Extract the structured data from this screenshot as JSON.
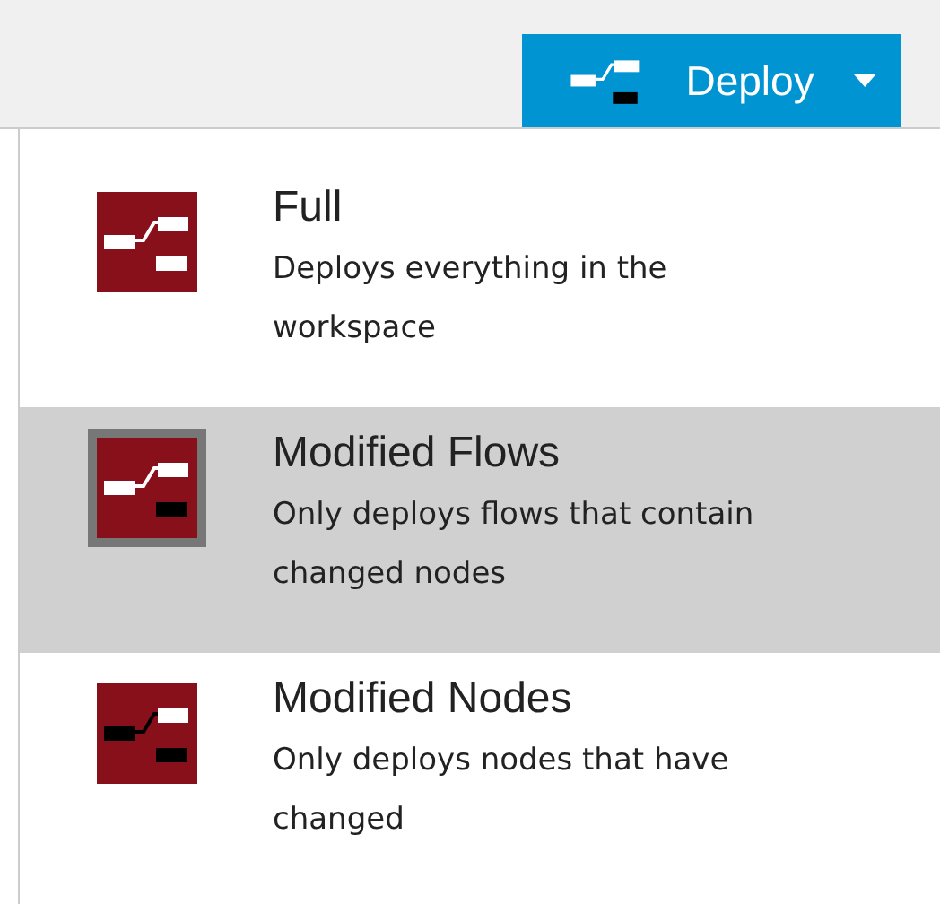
{
  "deploy_button": {
    "label": "Deploy",
    "expanded": true
  },
  "menu": [
    {
      "kind": "full",
      "title": "Full",
      "description": "Deploys everything in the workspace",
      "selected": false
    },
    {
      "kind": "flows",
      "title": "Modified Flows",
      "description": "Only deploys flows that contain changed nodes",
      "selected": true
    },
    {
      "kind": "nodes",
      "title": "Modified Nodes",
      "description": "Only deploys nodes that have changed",
      "selected": false
    }
  ]
}
